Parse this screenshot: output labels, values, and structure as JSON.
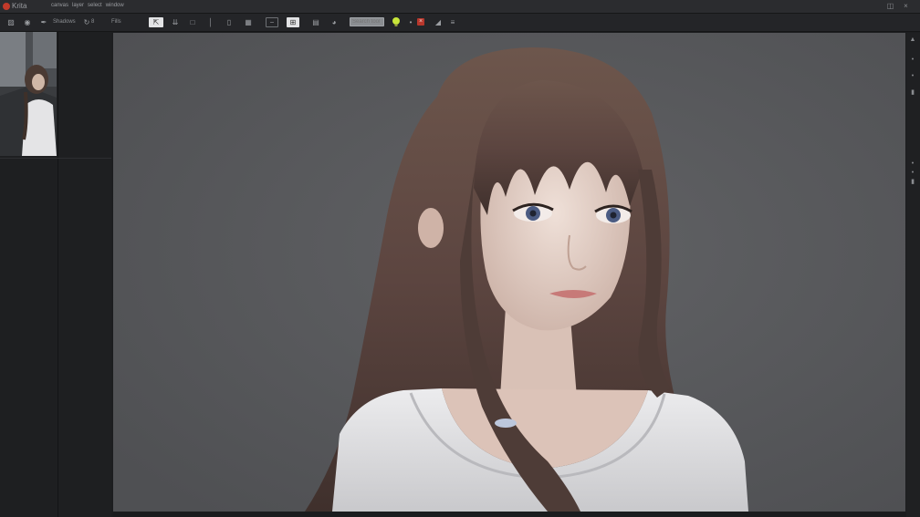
{
  "app": {
    "name": "Krita",
    "logo_icon": "app-logo-icon",
    "brand_color": "#c23a2a"
  },
  "menu": {
    "items": [
      "canvas",
      "layer",
      "select",
      "window"
    ]
  },
  "toolbar": {
    "brush_label": "Shadows",
    "brush_size": "8",
    "fill_label": "Fills",
    "search_placeholder": "Search tool",
    "tools": [
      "pointer-icon",
      "transform-icon",
      "crop-icon",
      "pen-icon",
      "shape-icon",
      "grid-icon",
      "frame-icon",
      "zoom-icon",
      "doc-icon",
      "globe-icon"
    ]
  },
  "canvas": {
    "background": "#595a5d"
  },
  "accent_colors": {
    "bulb": "#c8e63a",
    "close": "#b8372c"
  }
}
